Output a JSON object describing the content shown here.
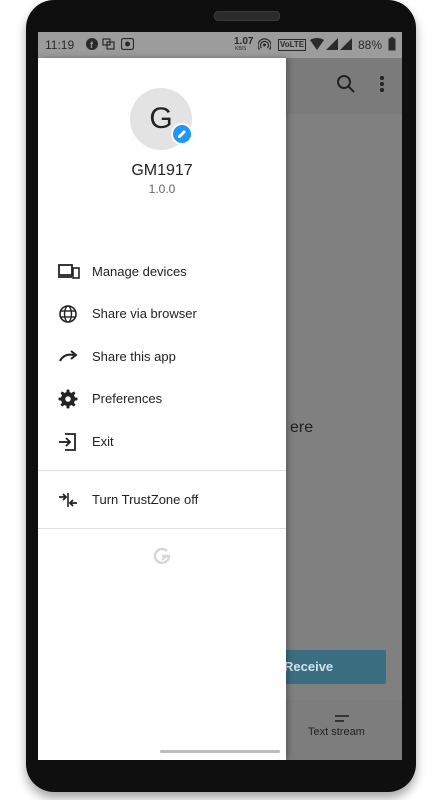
{
  "status_bar": {
    "time": "11:19",
    "net_speed": "1.07",
    "net_unit": "KB/S",
    "volte": "VoLTE",
    "battery": "88%"
  },
  "background": {
    "partial_text": "ere",
    "receive_label": "Receive",
    "bottom_tab_label": "Text stream"
  },
  "drawer": {
    "avatar_letter": "G",
    "device_name": "GM1917",
    "version": "1.0.0",
    "items": [
      {
        "label": "Manage devices",
        "icon": "devices-icon"
      },
      {
        "label": "Share via browser",
        "icon": "globe-icon"
      },
      {
        "label": "Share this app",
        "icon": "share-arrow-icon"
      },
      {
        "label": "Preferences",
        "icon": "gear-icon"
      },
      {
        "label": "Exit",
        "icon": "exit-icon"
      }
    ],
    "trustzone_label": "Turn TrustZone off"
  },
  "colors": {
    "accent": "#2196f3",
    "receive_button": "#3b6e80"
  }
}
